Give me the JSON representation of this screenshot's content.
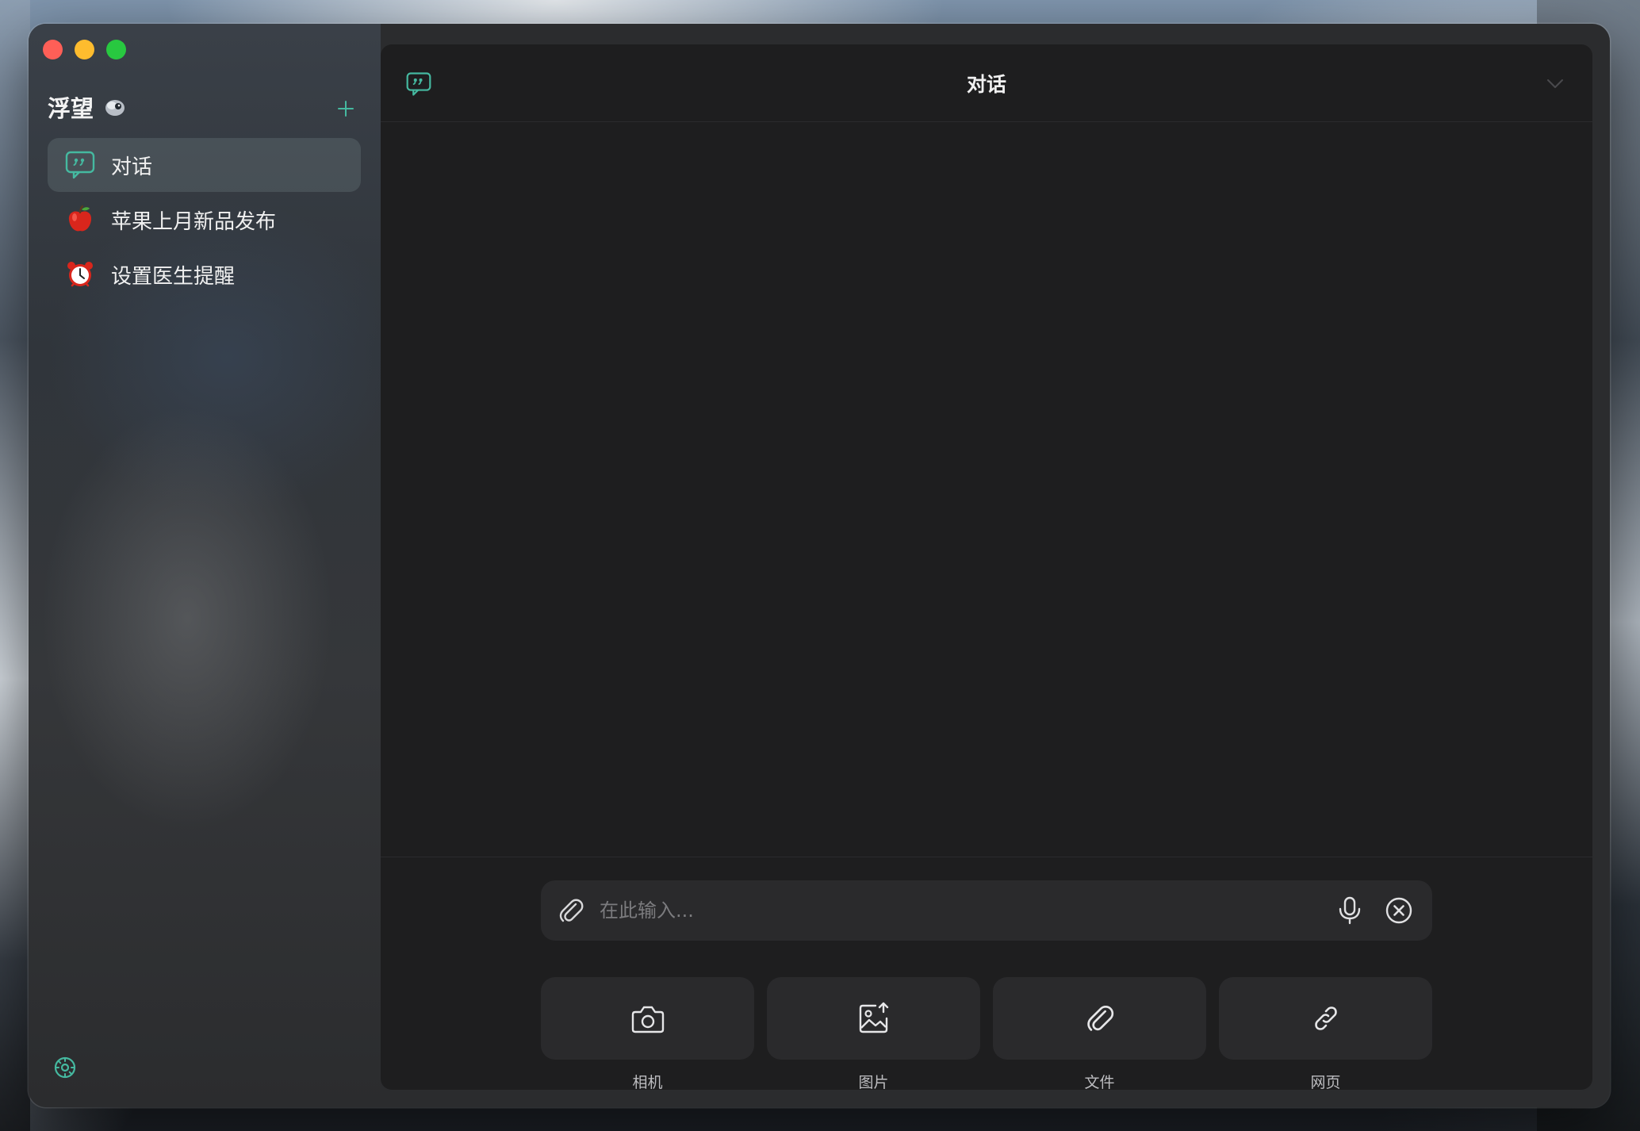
{
  "sidebar": {
    "app_name": "浮望",
    "items": [
      {
        "label": "对话",
        "icon": "chat-bubble-icon",
        "active": true
      },
      {
        "label": "苹果上月新品发布",
        "icon": "apple-emoji-icon",
        "active": false
      },
      {
        "label": "设置医生提醒",
        "icon": "alarm-clock-emoji-icon",
        "active": false
      }
    ]
  },
  "header": {
    "title": "对话"
  },
  "composer": {
    "placeholder": "在此输入..."
  },
  "tools": [
    {
      "label": "相机",
      "icon": "camera-icon"
    },
    {
      "label": "图片",
      "icon": "image-upload-icon"
    },
    {
      "label": "文件",
      "icon": "paperclip-icon"
    },
    {
      "label": "网页",
      "icon": "link-icon"
    }
  ],
  "colors": {
    "accent": "#45b9a0",
    "panel": "#1e1e1f",
    "sidebar": "#30353b"
  }
}
